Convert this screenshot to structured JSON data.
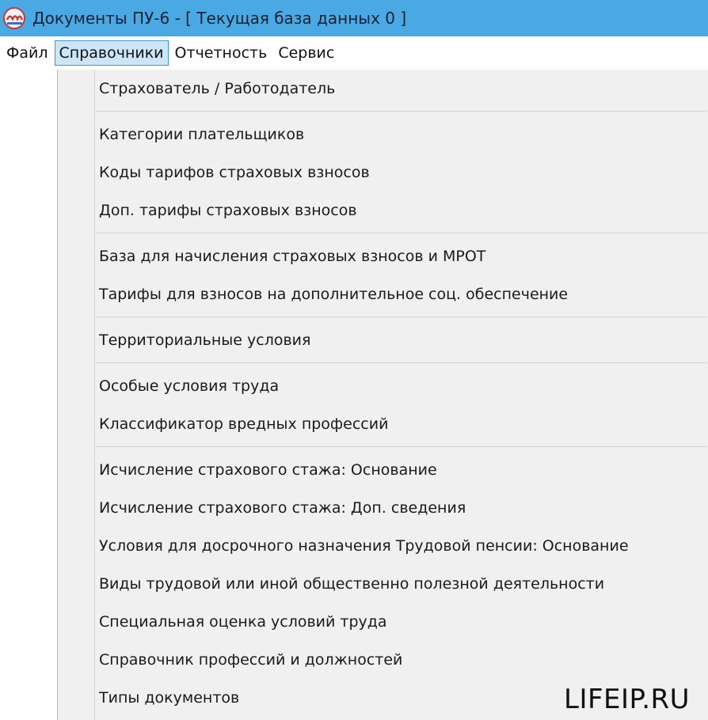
{
  "window": {
    "title": "Документы ПУ-6  -  [ Текущая база данных 0 ]",
    "logo_icon": "pfr-logo-icon"
  },
  "menubar": {
    "items": [
      {
        "label": "Файл",
        "active": false
      },
      {
        "label": "Справочники",
        "active": true
      },
      {
        "label": "Отчетность",
        "active": false
      },
      {
        "label": "Сервис",
        "active": false
      }
    ]
  },
  "dropdown": {
    "items": [
      {
        "label": "Страхователь / Работодатель"
      },
      {
        "label": "Категории плательщиков"
      },
      {
        "label": "Коды тарифов страховых взносов"
      },
      {
        "label": "Доп. тарифы страховых взносов"
      },
      {
        "label": "База для начисления страховых взносов и МРОТ"
      },
      {
        "label": "Тарифы для взносов на дополнительное соц. обеспечение"
      },
      {
        "label": "Территориальные условия"
      },
      {
        "label": "Особые условия труда"
      },
      {
        "label": "Классификатор вредных профессий"
      },
      {
        "label": "Исчисление страхового стажа: Основание"
      },
      {
        "label": "Исчисление страхового стажа: Доп. сведения"
      },
      {
        "label": "Условия для досрочного назначения Трудовой пенсии: Основание"
      },
      {
        "label": "Виды трудовой или иной общественно полезной деятельности"
      },
      {
        "label": "Специальная оценка условий труда"
      },
      {
        "label": "Справочник профессий и должностей"
      },
      {
        "label": "Типы документов"
      }
    ]
  },
  "watermark": {
    "text": "LIFEIP.RU"
  },
  "colors": {
    "titlebar": "#4aa8e3",
    "menu_active_bg": "#cce6f7",
    "menu_active_border": "#3c97d6",
    "dropdown_bg": "#f0f0f0"
  }
}
